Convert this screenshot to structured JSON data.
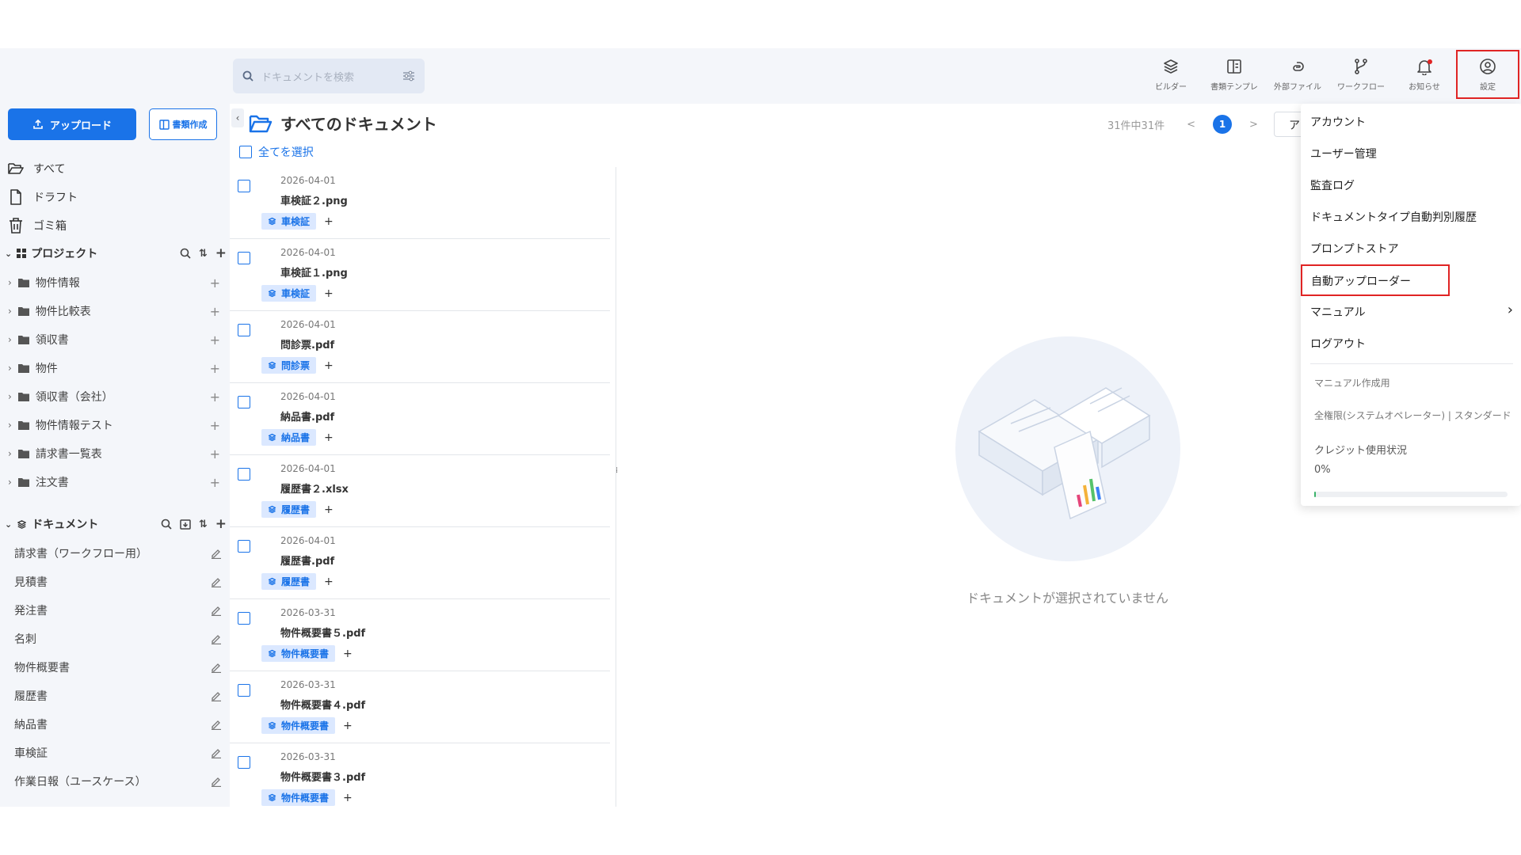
{
  "header": {
    "search_placeholder": "ドキュメントを検索",
    "icons": [
      {
        "key": "builder",
        "label": "ビルダー",
        "icon": "layers-icon"
      },
      {
        "key": "templates",
        "label": "書類テンプレ",
        "icon": "template-icon"
      },
      {
        "key": "external",
        "label": "外部ファイル",
        "icon": "paperclip-icon"
      },
      {
        "key": "workflow",
        "label": "ワークフロー",
        "icon": "branch-icon"
      },
      {
        "key": "notifications",
        "label": "お知らせ",
        "icon": "bell-icon"
      },
      {
        "key": "settings",
        "label": "設定",
        "icon": "user-circle-icon"
      }
    ]
  },
  "sidebar": {
    "upload_label": "アップロード",
    "create_label": "書類作成",
    "nav": [
      {
        "label": "すべて",
        "icon": "folder-open-icon"
      },
      {
        "label": "ドラフト",
        "icon": "file-icon"
      },
      {
        "label": "ゴミ箱",
        "icon": "trash-icon"
      }
    ],
    "projects_title": "プロジェクト",
    "projects": [
      "物件情報",
      "物件比較表",
      "領収書",
      "物件",
      "領収書（会社）",
      "物件情報テスト",
      "請求書一覧表",
      "注文書"
    ],
    "documents_title": "ドキュメント",
    "documents": [
      "請求書（ワークフロー用）",
      "見積書",
      "発注書",
      "名刺",
      "物件概要書",
      "履歴書",
      "納品書",
      "車検証",
      "作業日報（ユースケース）"
    ]
  },
  "list": {
    "title": "すべてのドキュメント",
    "select_all": "全てを選択",
    "rows": [
      {
        "date": "2026-04-01",
        "name": "車検証２.png",
        "tag": "車検証"
      },
      {
        "date": "2026-04-01",
        "name": "車検証１.png",
        "tag": "車検証"
      },
      {
        "date": "2026-04-01",
        "name": "問診票.pdf",
        "tag": "問診票"
      },
      {
        "date": "2026-04-01",
        "name": "納品書.pdf",
        "tag": "納品書"
      },
      {
        "date": "2026-04-01",
        "name": "履歴書２.xlsx",
        "tag": "履歴書"
      },
      {
        "date": "2026-04-01",
        "name": "履歴書.pdf",
        "tag": "履歴書"
      },
      {
        "date": "2026-03-31",
        "name": "物件概要書５.pdf",
        "tag": "物件概要書"
      },
      {
        "date": "2026-03-31",
        "name": "物件概要書４.pdf",
        "tag": "物件概要書"
      },
      {
        "date": "2026-03-31",
        "name": "物件概要書３.pdf",
        "tag": "物件概要書"
      }
    ]
  },
  "pager": {
    "count": "31件中31件",
    "prev": "<",
    "page": "1",
    "next": ">",
    "btn": "ア"
  },
  "empty_text": "ドキュメントが選択されていません",
  "menu": {
    "items": [
      "アカウント",
      "ユーザー管理",
      "監査ログ",
      "ドキュメントタイプ自動判別履歴",
      "プロンプトストア",
      "自動アップローダー",
      "マニュアル",
      "ログアウト"
    ],
    "manual_arrow": "›",
    "sub1": "マニュアル作成用",
    "sub2": "全権限(システムオペレーター) | スタンダード",
    "credit_label": "クレジット使用状況",
    "credit_value": "0%",
    "credit_fraction": 0.0
  },
  "colors": {
    "accent": "#1a73e8",
    "highlight": "#e02424"
  }
}
